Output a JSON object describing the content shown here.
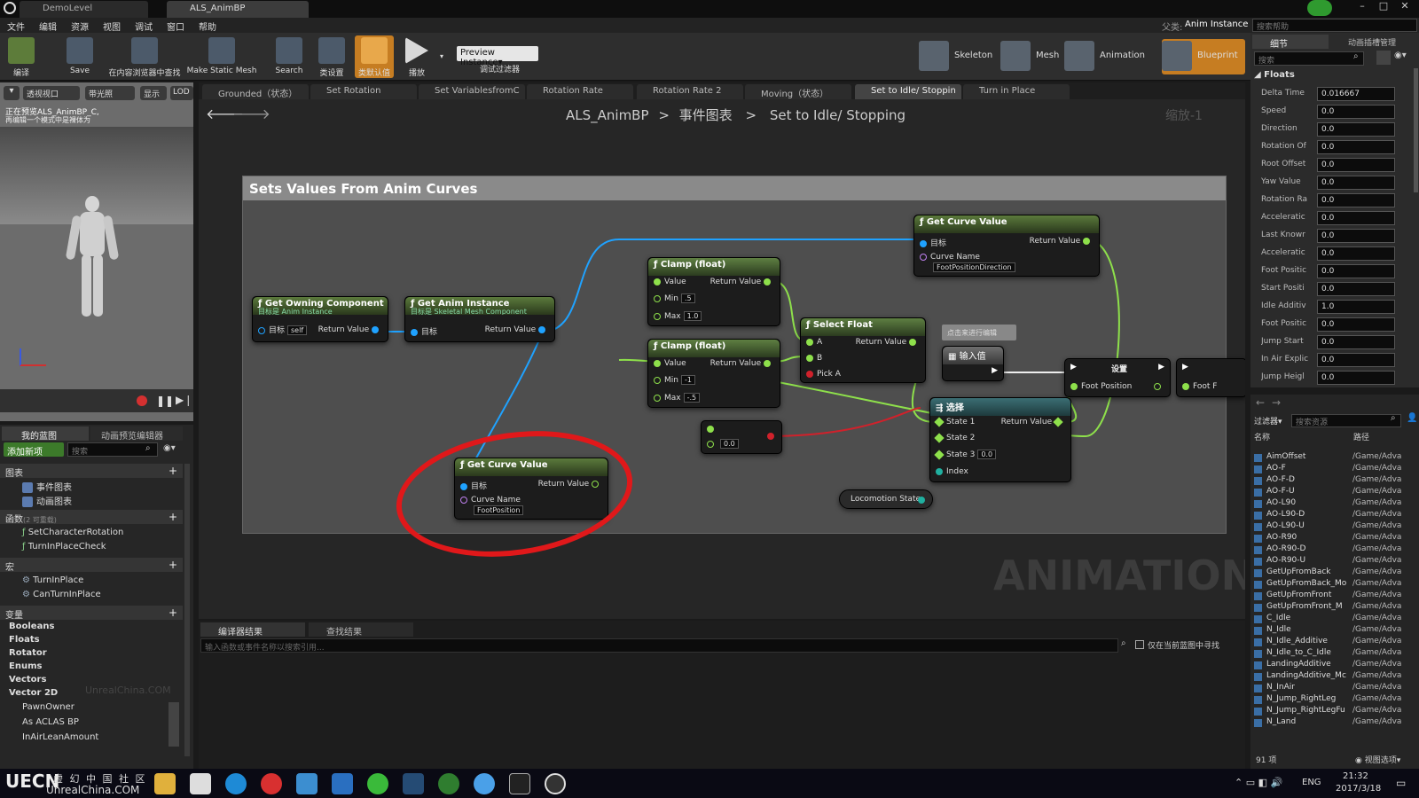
{
  "window": {
    "tabs": [
      "DemoLevel",
      "ALS_AnimBP"
    ],
    "parent_label": "父类:",
    "parent_value": "Anim Instance",
    "help_placeholder": "搜索帮助"
  },
  "menu": [
    "文件",
    "编辑",
    "资源",
    "视图",
    "调试",
    "窗口",
    "帮助"
  ],
  "toolbar": {
    "buttons": [
      "编译",
      "Save",
      "在内容浏览器中查找",
      "Make Static Mesh",
      "Search",
      "类设置",
      "类默认值",
      "播放"
    ],
    "preview": "Preview Instance▾",
    "debug_filter": "调试过滤器",
    "modes": [
      "Skeleton",
      "Mesh",
      "Animation",
      "Blueprint"
    ]
  },
  "viewport": {
    "btns": [
      "透视视口",
      "带光照",
      "显示",
      "LOD"
    ],
    "line1": "正在预览ALS_AnimBP_C,",
    "line2": "再编辑一个模式中是裸体为"
  },
  "bp_tabs": [
    "Grounded（状态）",
    "Set Rotation",
    "Set VariablesfromC",
    "Rotation Rate",
    "Rotation Rate 2",
    "Moving（状态）",
    "Set to Idle/ Stoppin",
    "Turn in Place"
  ],
  "breadcrumb": {
    "root": "ALS_AnimBP",
    "sep": ">",
    "graph": "事件图表",
    "leaf": "Set to Idle/ Stopping",
    "zoom": "缩放-1"
  },
  "watermark": "ANIMATION",
  "comment": "Sets Values From Anim Curves",
  "nodes": {
    "owning": {
      "title": "Get Owning Component",
      "sub": "目标是 Anim Instance",
      "target": "目标",
      "self": "self",
      "ret": "Return Value"
    },
    "animinst": {
      "title": "Get Anim Instance",
      "sub": "目标是 Skeletal Mesh Component",
      "target": "目标",
      "ret": "Return Value"
    },
    "curve1": {
      "title": "Get Curve Value",
      "target": "目标",
      "ret": "Return Value",
      "cn": "Curve Name",
      "cv": "FootPositionDirection"
    },
    "clamp1": {
      "title": "Clamp (float)",
      "value": "Value",
      "ret": "Return Value",
      "min": "Min",
      "minv": ".5",
      "max": "Max",
      "maxv": "1.0"
    },
    "clamp2": {
      "title": "Clamp (float)",
      "value": "Value",
      "ret": "Return Value",
      "min": "Min",
      "minv": "-1",
      "max": "Max",
      "maxv": "-.5"
    },
    "selfloat": {
      "title": "Select Float",
      "a": "A",
      "ret": "Return Value",
      "b": "B",
      "pick": "Pick A"
    },
    "tooltip": "点击来进行编辑",
    "input": {
      "title": "输入值"
    },
    "set": {
      "title": "设置",
      "pin": "Foot Position"
    },
    "set2": {
      "pin": "Foot F"
    },
    "select": {
      "title": "选择",
      "s1": "State 1",
      "ret": "Return Value",
      "s2": "State 2",
      "s3": "State 3",
      "s3v": "0.0",
      "idx": "Index"
    },
    "locstate": "Locomotion State",
    "zero": "0.0",
    "curve2": {
      "title": "Get Curve Value",
      "target": "目标",
      "ret": "Return Value",
      "cn": "Curve Name",
      "cv": "FootPosition"
    }
  },
  "results": {
    "tabs": [
      "编译器结果",
      "查找结果"
    ],
    "placeholder": "输入函数或事件名称以搜索引用...",
    "check": "仅在当前蓝图中寻找"
  },
  "details": {
    "tabs": [
      "细节",
      "动画插槽管理"
    ],
    "search": "搜索",
    "section": "Floats",
    "rows": [
      [
        "Delta Time",
        "0.016667"
      ],
      [
        "Speed",
        "0.0"
      ],
      [
        "Direction",
        "0.0"
      ],
      [
        "Rotation Of",
        "0.0"
      ],
      [
        "Root Offset",
        "0.0"
      ],
      [
        "Yaw Value",
        "0.0"
      ],
      [
        "Rotation Ra",
        "0.0"
      ],
      [
        "Acceleratic",
        "0.0"
      ],
      [
        "Last Knowr",
        "0.0"
      ],
      [
        "Acceleratic",
        "0.0"
      ],
      [
        "Foot Positic",
        "0.0"
      ],
      [
        "Start Positi",
        "0.0"
      ],
      [
        "Idle Additiv",
        "1.0"
      ],
      [
        "Foot Positic",
        "0.0"
      ],
      [
        "Jump Start",
        "0.0"
      ],
      [
        "In Air Explic",
        "0.0"
      ],
      [
        "Jump Heigl",
        "0.0"
      ]
    ]
  },
  "assets": {
    "filter": "过滤器",
    "search": "搜索资源",
    "col_name": "名称",
    "col_path": "路径",
    "count": "91 项",
    "view": "视图选项",
    "items": [
      "AimOffset",
      "AO-F",
      "AO-F-D",
      "AO-F-U",
      "AO-L90",
      "AO-L90-D",
      "AO-L90-U",
      "AO-R90",
      "AO-R90-D",
      "AO-R90-U",
      "GetUpFromBack",
      "GetUpFromBack_Mo",
      "GetUpFromFront",
      "GetUpFromFront_M",
      "C_Idle",
      "N_Idle",
      "N_Idle_Additive",
      "N_Idle_to_C_Idle",
      "LandingAdditive",
      "LandingAdditive_Mc",
      "N_InAir",
      "N_Jump_RightLeg",
      "N_Jump_RightLegFu",
      "N_Land"
    ],
    "path": "/Game/Adva"
  },
  "mybp": {
    "tabs": [
      "我的蓝图",
      "动画预览编辑器"
    ],
    "add": "添加新项",
    "search": "搜索",
    "graphs": "图表",
    "g1": "事件图表",
    "g2": "动画图表",
    "funcs": "函数",
    "funcs_count": "(2 可重载)",
    "f1": "SetCharacterRotation",
    "f2": "TurnInPlaceCheck",
    "macros": "宏",
    "m1": "TurnInPlace",
    "m2": "CanTurnInPlace",
    "vars": "变量",
    "v": [
      "Booleans",
      "Floats",
      "Rotator",
      "Enums",
      "Vectors",
      "Vector 2D"
    ],
    "vi": [
      "PawnOwner",
      "As ACLAS BP",
      "InAirLeanAmount"
    ],
    "wm": "UnrealChina.COM"
  },
  "taskbar": {
    "lang": "ENG",
    "time": "21:32",
    "date": "2017/3/18",
    "logo1": "虚 幻 中 国 社 区",
    "logo2": "UnrealChina.COM"
  }
}
